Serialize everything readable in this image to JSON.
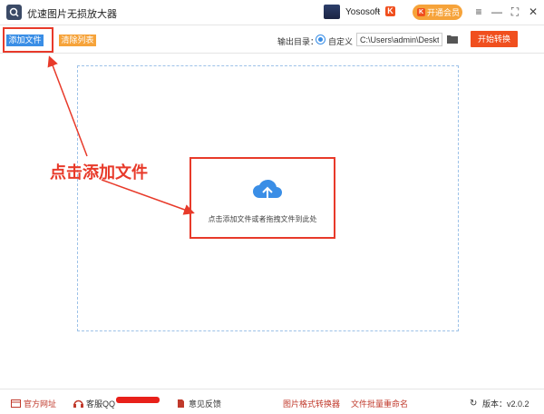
{
  "app": {
    "title": "优速图片无损放大器"
  },
  "user": {
    "name": "Yososoft",
    "vip_badge": "K"
  },
  "vip_button": {
    "label": "开通会员",
    "icon": "K"
  },
  "window_controls": {
    "menu": "≡",
    "minimize": "—",
    "maximize": "⛶",
    "close": "✕"
  },
  "toolbar": {
    "add_label": "添加文件",
    "clear_label": "清除列表",
    "output_label": "输出目录：",
    "custom_label": "自定义",
    "path_value": "C:\\Users\\admin\\Deskto",
    "start_label": "开始转换"
  },
  "dropzone": {
    "text": "点击添加文件或者拖拽文件到此处"
  },
  "annotation": {
    "text": "点击添加文件"
  },
  "footer": {
    "website": "官方网址",
    "support": "客服QQ",
    "feedback": "意见反馈",
    "format_converter": "图片格式转换器",
    "batch_rename": "文件批量重命名",
    "version": "版本：v2.0.2"
  },
  "colors": {
    "accent_blue": "#3a8ee6",
    "accent_orange": "#f6a33a",
    "accent_red": "#f04f1e",
    "annotation_red": "#e83a2a"
  },
  "icons": [
    "app-logo-icon",
    "chevron-down-icon",
    "folder-icon",
    "cloud-upload-icon",
    "globe-icon",
    "headset-icon",
    "document-icon",
    "refresh-icon"
  ]
}
